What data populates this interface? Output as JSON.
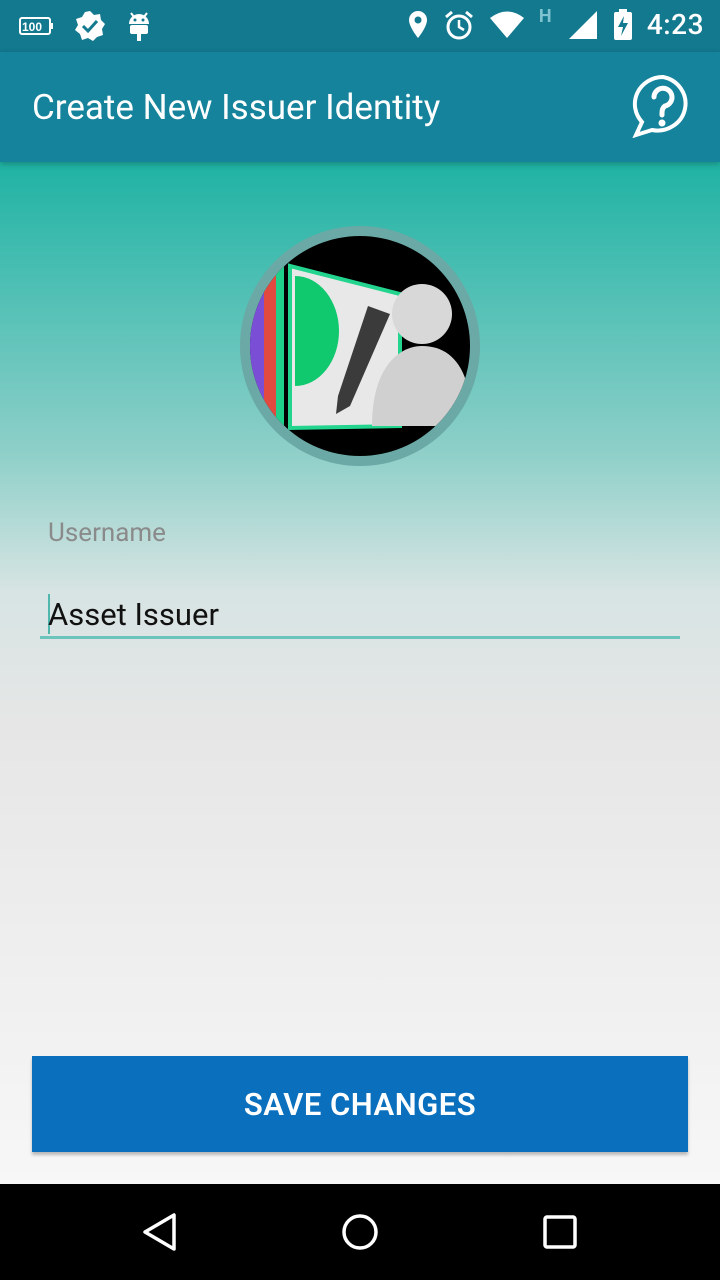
{
  "status_bar": {
    "time": "4:23",
    "left_icons": [
      "battery-100-icon",
      "check-badge-icon",
      "android-debug-icon"
    ],
    "right_icons": [
      "location-icon",
      "alarm-icon",
      "wifi-icon",
      "h-network-icon",
      "signal-icon",
      "battery-charging-icon"
    ],
    "network_label": "H"
  },
  "app_bar": {
    "title": "Create New Issuer Identity",
    "help_icon": "help-icon"
  },
  "form": {
    "username_label": "Username",
    "username_value": "Asset Issuer"
  },
  "save_button": {
    "label": "SAVE CHANGES",
    "color": "#0a6fbd"
  },
  "nav_bar": {
    "icons": [
      "back-icon",
      "home-icon",
      "recents-icon"
    ]
  },
  "colors": {
    "status_bar": "#13798f",
    "app_bar": "#14839b",
    "accent": "#6cc4bd"
  }
}
